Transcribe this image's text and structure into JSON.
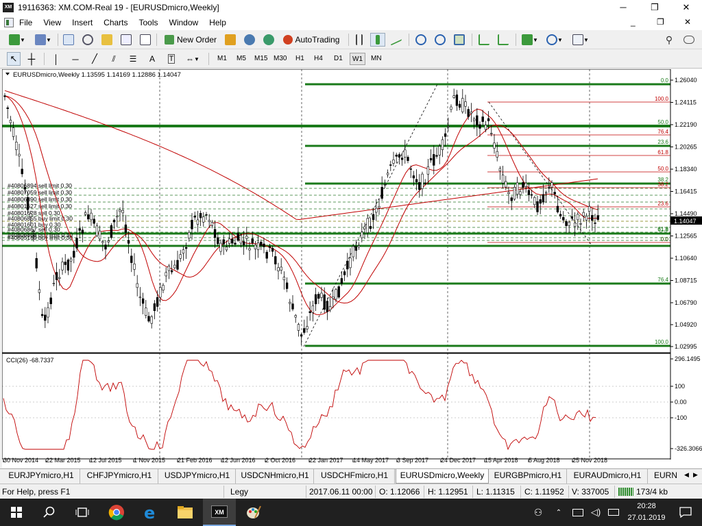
{
  "window": {
    "title": "19116363: XM.COM-Real 19 - [EURUSDmicro,Weekly]",
    "app_icon_text": "XM",
    "minimize": "─",
    "restore": "❐",
    "close": "✕"
  },
  "menu": [
    "File",
    "View",
    "Insert",
    "Charts",
    "Tools",
    "Window",
    "Help"
  ],
  "toolbar": {
    "new_order": "New Order",
    "autotrading": "AutoTrading",
    "icons": [
      "new-chart-icon",
      "profiles-icon",
      "market-watch-icon",
      "navigator-icon",
      "data-window-icon",
      "terminal-icon",
      "tester-icon",
      "new-order-icon",
      "metaeditor-icon",
      "signals-icon",
      "market-icon",
      "autotrading-icon",
      "bar-chart-icon",
      "candlestick-icon",
      "line-chart-icon",
      "zoom-in-icon",
      "zoom-out-icon",
      "tile-windows-icon",
      "chart-shift-icon",
      "autoscroll-icon",
      "indicators-icon",
      "periods-icon",
      "templates-icon",
      "search-icon",
      "chat-icon"
    ]
  },
  "tools": {
    "icons": [
      "cursor-icon",
      "crosshair-icon",
      "vertical-line-icon",
      "horizontal-line-icon",
      "trendline-icon",
      "equidistant-channel-icon",
      "fibonacci-icon",
      "text-icon",
      "text-label-icon",
      "arrows-icon"
    ],
    "timeframes": [
      "M1",
      "M5",
      "M15",
      "M30",
      "H1",
      "H4",
      "D1",
      "W1",
      "MN"
    ],
    "active_timeframe": "W1"
  },
  "chart": {
    "header": "EURUSDmicro,Weekly  1.13595 1.14169 1.12886 1.14047",
    "current_price": "1.14047",
    "price_axis": [
      "1.26040",
      "1.24115",
      "1.22190",
      "1.20265",
      "1.18340",
      "1.16415",
      "1.14490",
      "1.12565",
      "1.10640",
      "1.08715",
      "1.06790",
      "1.04920",
      "1.02995"
    ],
    "date_axis": [
      "30 Nov 2014",
      "22 Mar 2015",
      "12 Jul 2015",
      "1 Nov 2015",
      "21 Feb 2016",
      "12 Jun 2016",
      "2 Oct 2016",
      "22 Jan 2017",
      "14 May 2017",
      "3 Sep 2017",
      "24 Dec 2017",
      "15 Apr 2018",
      "5 Aug 2018",
      "25 Nov 2018"
    ],
    "order_labels": [
      "#40806894 sell limit 0.30",
      "#40807059 sell limit 0.30",
      "#40806890 sell limit 0.30",
      "#40801627 sell limit 0.30",
      "#40801628 sell 0.30",
      "#40806855 buy limit 0.30",
      "#40801601 buy 0.30",
      "#40806867 sell 0.30",
      "#40806868 buy limit 0.30",
      "#40805169 buy limit 0.30"
    ],
    "fib_big": [
      "0.0",
      "50.0",
      "23.6",
      "38.2",
      "61.8",
      "76.4",
      "100.0"
    ],
    "fib_small": [
      "100.0",
      "76.4",
      "61.8",
      "50.0",
      "38.2",
      "23.6",
      "0.0"
    ],
    "fib_lower": [
      "61.8",
      "0.0"
    ],
    "cci": {
      "label": "CCI(26) -68.7337",
      "axis": [
        "296.1495",
        "100",
        "0.00",
        "-100",
        "-326.3066"
      ]
    }
  },
  "tabs": [
    "EURJPYmicro,H1",
    "CHFJPYmicro,H1",
    "USDJPYmicro,H1",
    "USDCNHmicro,H1",
    "USDCHFmicro,H1",
    "EURUSDmicro,Weekly",
    "EURGBPmicro,H1",
    "EURAUDmicro,H1",
    "EURN"
  ],
  "active_tab": "EURUSDmicro,Weekly",
  "status": {
    "help": "For Help, press F1",
    "profile": "Legy",
    "datetime": "2017.06.11 00:00",
    "open": "O: 1.12066",
    "high": "H: 1.12951",
    "low": "L: 1.11315",
    "close": "C: 1.11952",
    "volume": "V: 337005",
    "traffic": "173/4 kb"
  },
  "taskbar": {
    "time": "20:28",
    "date": "27.01.2019",
    "icons": [
      "start-icon",
      "search-icon",
      "task-view-icon",
      "chrome-icon",
      "edge-icon",
      "file-explorer-icon",
      "xm-terminal-icon",
      "paint-icon",
      "people-icon",
      "network-icon",
      "volume-icon",
      "keyboard-icon",
      "action-center-icon"
    ]
  },
  "colors": {
    "fib_green": "#1a7a1a",
    "red_line": "#c00000",
    "candles": "#000000"
  }
}
